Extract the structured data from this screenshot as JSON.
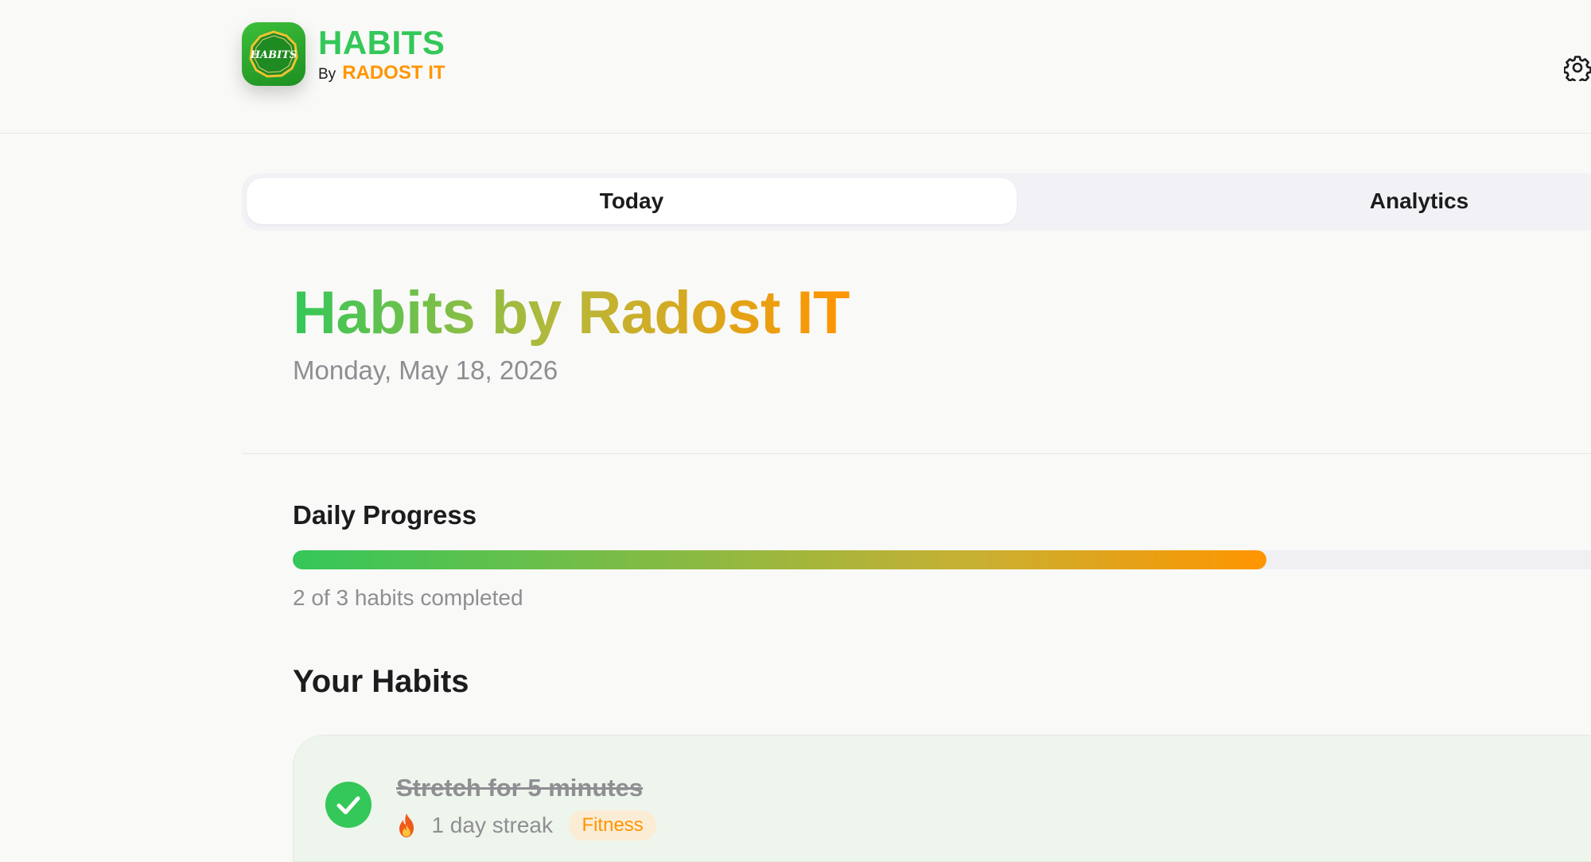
{
  "header": {
    "brand_title": "HABITS",
    "brand_by": "By",
    "brand_company": "RADOST IT",
    "logo_text": "HABITS",
    "settings_icon": "gear-icon"
  },
  "tabs": [
    {
      "label": "Today",
      "active": true
    },
    {
      "label": "Analytics",
      "active": false
    }
  ],
  "hero": {
    "title": "Habits by Radost IT",
    "date": "Monday, May 18, 2026"
  },
  "progress": {
    "title": "Daily Progress",
    "completed": 2,
    "total": 3,
    "caption": "2 of 3 habits completed"
  },
  "habits_section": {
    "title": "Your Habits",
    "items": [
      {
        "name": "Stretch for 5 minutes",
        "completed": true,
        "streak_icon": "flame-icon",
        "streak": "1 day streak",
        "category": "Fitness"
      }
    ]
  },
  "colors": {
    "brand_green": "#34c759",
    "brand_orange": "#ff9500",
    "muted_text": "#8e8e93",
    "background": "#f9f9f7"
  }
}
